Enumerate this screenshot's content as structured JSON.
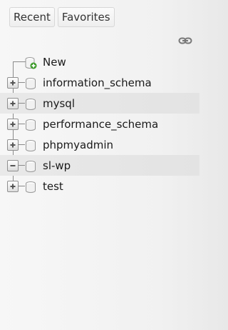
{
  "tabs": {
    "recent": "Recent",
    "favorites": "Favorites"
  },
  "toolbar": {
    "link_icon": "link-icon"
  },
  "tree": {
    "new_label": "New",
    "databases": [
      {
        "label": "information_schema",
        "expander": "plus",
        "highlighted": false
      },
      {
        "label": "mysql",
        "expander": "plus",
        "highlighted": true
      },
      {
        "label": "performance_schema",
        "expander": "plus",
        "highlighted": false
      },
      {
        "label": "phpmyadmin",
        "expander": "plus",
        "highlighted": false
      },
      {
        "label": "sl-wp",
        "expander": "minus",
        "highlighted": true
      },
      {
        "label": "test",
        "expander": "plus",
        "highlighted": false
      }
    ]
  },
  "colors": {
    "highlight": "#e5e5e5",
    "new_badge": "#3b9a2a"
  }
}
